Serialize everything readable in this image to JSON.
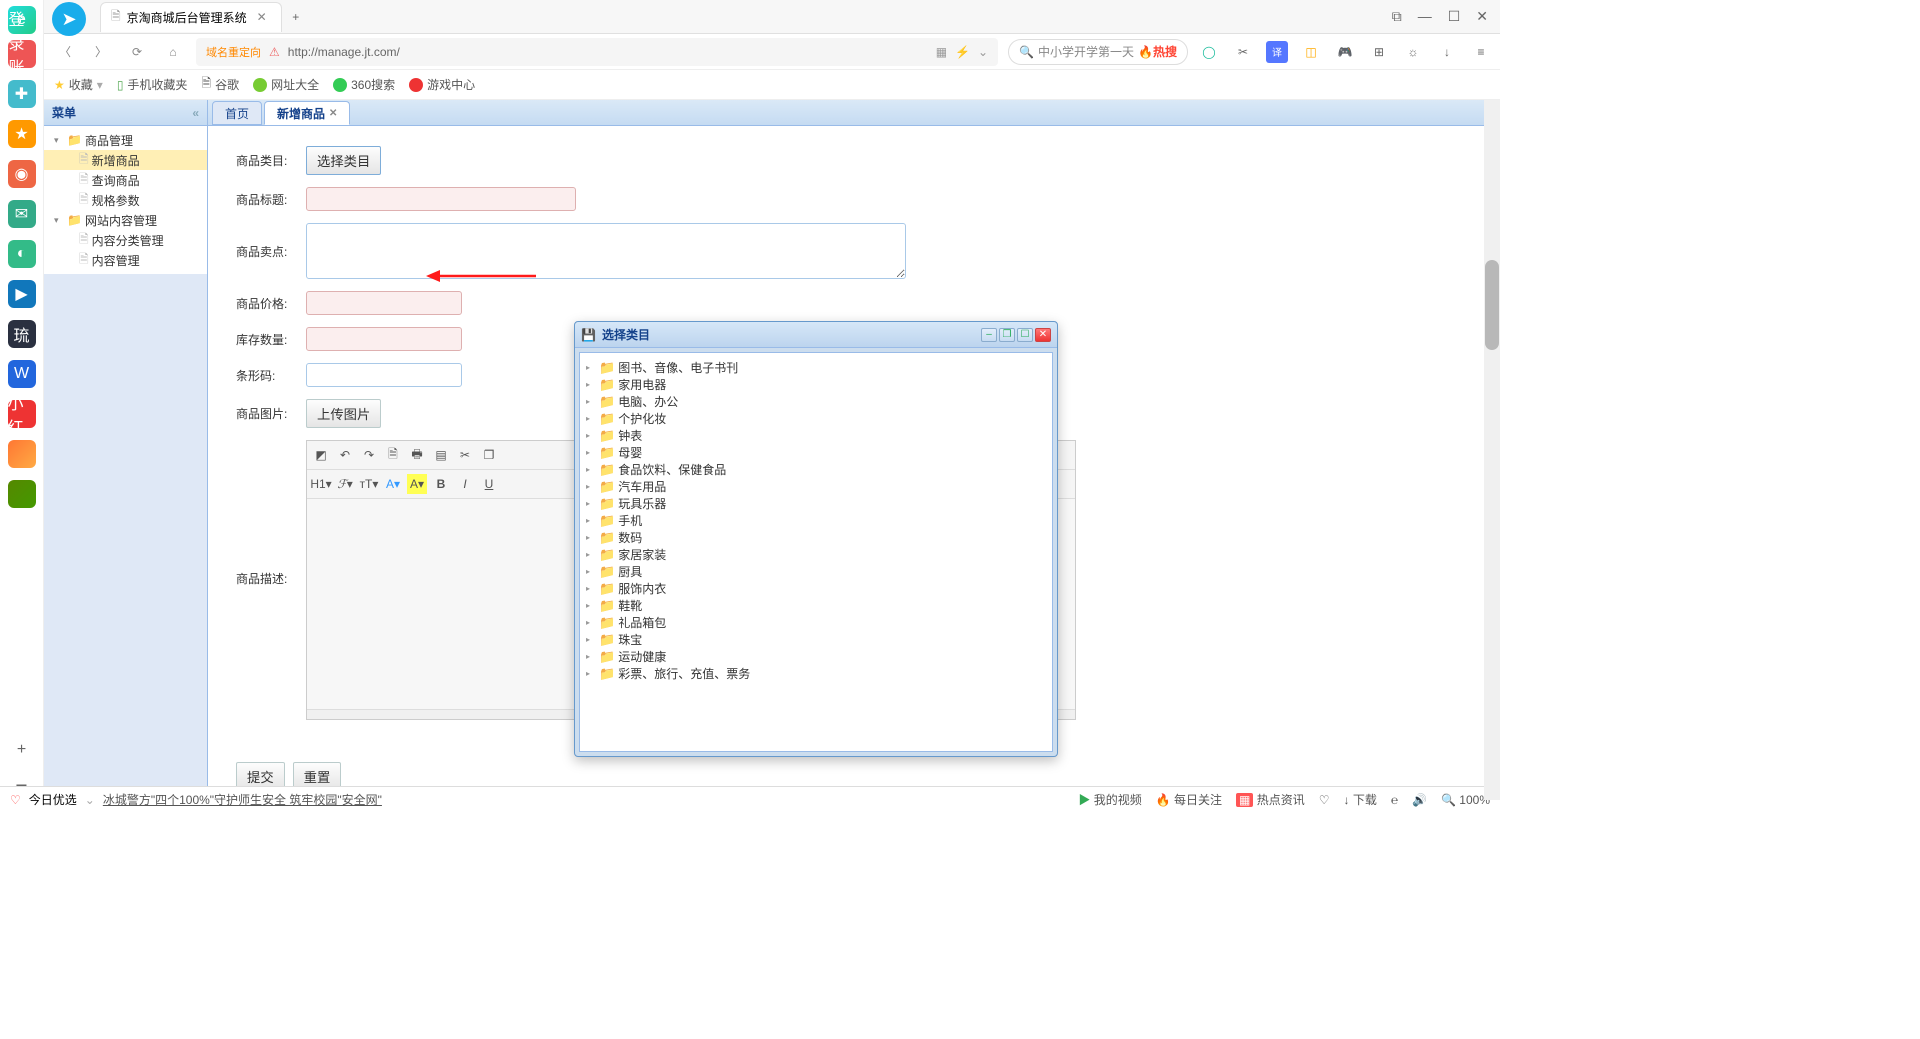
{
  "browser": {
    "tab_title": "京淘商城后台管理系统",
    "login_badge": "登录账号",
    "url_redirect_label": "域名重定向",
    "url": "http://manage.jt.com/",
    "search_placeholder": "中小学开学第一天",
    "search_hot": "热搜",
    "win": {
      "ext": "⧉",
      "min": "—",
      "max": "☐",
      "close": "✕"
    }
  },
  "bookmarks": {
    "fav": "收藏",
    "mobile": "手机收藏夹",
    "google": "谷歌",
    "urls": "网址大全",
    "search360": "360搜索",
    "gamecenter": "游戏中心"
  },
  "sidebar": {
    "title": "菜单",
    "nodes": {
      "product_mgmt": "商品管理",
      "add_product": "新增商品",
      "query_product": "查询商品",
      "spec_param": "规格参数",
      "content_mgmt": "网站内容管理",
      "content_cat": "内容分类管理",
      "content": "内容管理"
    }
  },
  "tabs": {
    "home": "首页",
    "add": "新增商品"
  },
  "form": {
    "category_label": "商品类目:",
    "category_btn": "选择类目",
    "title_label": "商品标题:",
    "sell_label": "商品卖点:",
    "price_label": "商品价格:",
    "stock_label": "库存数量:",
    "barcode_label": "条形码:",
    "image_label": "商品图片:",
    "image_btn": "上传图片",
    "desc_label": "商品描述:",
    "submit": "提交",
    "reset": "重置"
  },
  "modal": {
    "title": "选择类目",
    "categories": [
      "图书、音像、电子书刊",
      "家用电器",
      "电脑、办公",
      "个护化妆",
      "钟表",
      "母婴",
      "食品饮料、保健食品",
      "汽车用品",
      "玩具乐器",
      "手机",
      "数码",
      "家居家装",
      "厨具",
      "服饰内衣",
      "鞋靴",
      "礼品箱包",
      "珠宝",
      "运动健康",
      "彩票、旅行、充值、票务"
    ]
  },
  "statusbar": {
    "today": "今日优选",
    "news": "冰城警方\"四个100%\"守护师生安全 筑牢校园\"安全网\"",
    "myvideo": "我的视频",
    "daily": "每日关注",
    "hotnews": "热点资讯",
    "download": "下载",
    "zoom": "100%"
  }
}
